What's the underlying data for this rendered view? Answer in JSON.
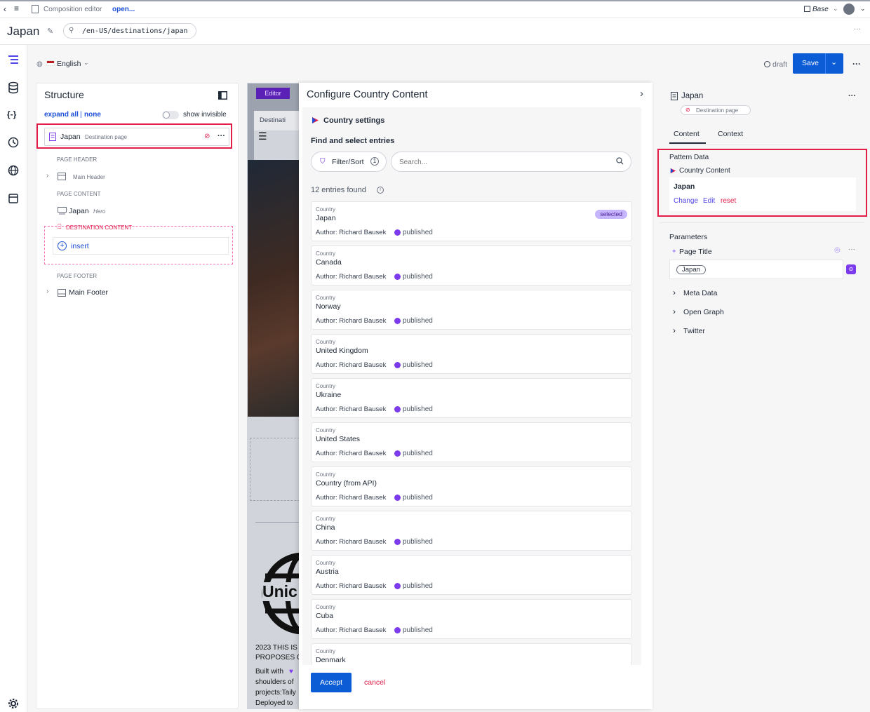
{
  "topbar": {
    "breadcrumb": "Composition editor",
    "open_link": "open...",
    "base_label": "Base"
  },
  "titlebar": {
    "title": "Japan",
    "path": "/en-US/destinations/japan"
  },
  "toolbar": {
    "locale": "English",
    "status": "draft",
    "save_label": "Save"
  },
  "structure": {
    "heading": "Structure",
    "expand_all": "expand all",
    "separator": "|",
    "none": "none",
    "show_invisible": "show invisible",
    "root": {
      "label": "Japan",
      "type": "Destination page"
    },
    "page_header": "PAGE HEADER",
    "main_header": "Main Header",
    "page_content": "PAGE CONTENT",
    "hero": {
      "label": "Japan",
      "type": "Hero"
    },
    "destination_content": "DESTINATION CONTENT",
    "insert": "insert",
    "page_footer": "PAGE FOOTER",
    "main_footer": "Main Footer"
  },
  "preview": {
    "editor_tab": "Editor",
    "crumb": "Destinati",
    "brand": "Unic",
    "text_lines": [
      "2023 THIS IS",
      "PROPOSES C",
      "Built with",
      "shoulders of",
      "projects:Taily",
      "Deployed to"
    ]
  },
  "dialog": {
    "title": "Configure Country Content",
    "section": "Country settings",
    "find": "Find and select entries",
    "filter": "Filter/Sort",
    "filter_count": "1",
    "search_placeholder": "Search...",
    "found": "12 entries found",
    "accept": "Accept",
    "cancel": "cancel",
    "entries": [
      {
        "category": "Country",
        "title": "Japan",
        "author": "Author: Richard Bausek",
        "status": "published",
        "selected": "selected"
      },
      {
        "category": "Country",
        "title": "Canada",
        "author": "Author: Richard Bausek",
        "status": "published"
      },
      {
        "category": "Country",
        "title": "Norway",
        "author": "Author: Richard Bausek",
        "status": "published"
      },
      {
        "category": "Country",
        "title": "United Kingdom",
        "author": "Author: Richard Bausek",
        "status": "published"
      },
      {
        "category": "Country",
        "title": "Ukraine",
        "author": "Author: Richard Bausek",
        "status": "published"
      },
      {
        "category": "Country",
        "title": "United States",
        "author": "Author: Richard Bausek",
        "status": "published"
      },
      {
        "category": "Country",
        "title": "Country (from API)",
        "author": "Author: Richard Bausek",
        "status": "published"
      },
      {
        "category": "Country",
        "title": "China",
        "author": "Author: Richard Bausek",
        "status": "published"
      },
      {
        "category": "Country",
        "title": "Austria",
        "author": "Author: Richard Bausek",
        "status": "published"
      },
      {
        "category": "Country",
        "title": "Cuba",
        "author": "Author: Richard Bausek",
        "status": "published"
      },
      {
        "category": "Country",
        "title": "Denmark"
      }
    ]
  },
  "props": {
    "title": "Japan",
    "type": "Destination page",
    "tab_content": "Content",
    "tab_context": "Context",
    "pattern_heading": "Pattern Data",
    "pattern_source": "Country Content",
    "pattern_value": "Japan",
    "change": "Change",
    "edit": "Edit",
    "reset": "reset",
    "params_heading": "Parameters",
    "page_title_label": "Page Title",
    "page_title_value": "Japan",
    "meta": "Meta Data",
    "og": "Open Graph",
    "twitter": "Twitter"
  },
  "colors": {
    "accent_blue": "#0b5cd5",
    "highlight_red": "#e11d48",
    "purple": "#7c3aed"
  }
}
